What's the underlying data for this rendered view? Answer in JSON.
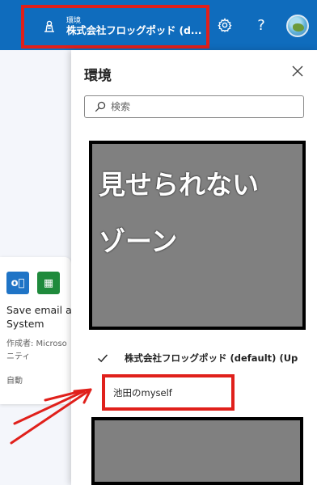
{
  "topbar": {
    "env_label_small": "環境",
    "env_name": "株式会社フロッグポッド (d...",
    "help_label": "?"
  },
  "background_card": {
    "title": "Save email at System",
    "title_line1": "Save email at",
    "title_line2": "System",
    "author_line1": "作成者: Microso",
    "author_line2": "ニティ",
    "trigger": "自動"
  },
  "panel": {
    "title": "環境",
    "search": {
      "placeholder": "検索",
      "value": ""
    },
    "hidden_zone_text_line1": "見せられない",
    "hidden_zone_text_line2": "ゾーン",
    "environments": [
      {
        "label": "株式会社フロッグポッド (default) (Up",
        "selected": true
      },
      {
        "label": "池田のmyself",
        "selected": false
      }
    ]
  },
  "colors": {
    "topbar": "#0f6cbd",
    "highlight_box": "#e0201b",
    "censor_fill": "#808080",
    "outlook_icon": "#1f74c6",
    "sheet_icon": "#1f8a3c"
  }
}
